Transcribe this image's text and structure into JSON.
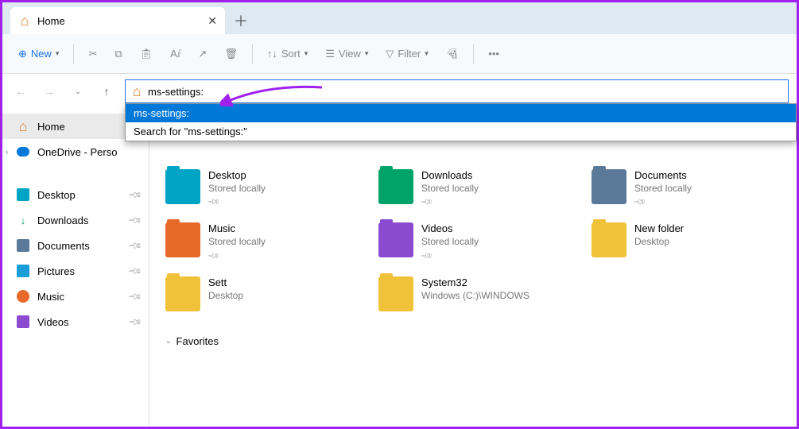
{
  "tab": {
    "title": "Home"
  },
  "toolbar": {
    "new_label": "New",
    "sort_label": "Sort",
    "view_label": "View",
    "filter_label": "Filter"
  },
  "address": {
    "value": "ms-settings:",
    "suggestions": [
      "ms-settings:",
      "Search for \"ms-settings:\""
    ]
  },
  "sidebar": {
    "items": [
      {
        "label": "Home",
        "icon": "home",
        "selected": true
      },
      {
        "label": "OneDrive - Perso",
        "icon": "cloud",
        "expandable": true
      }
    ],
    "pinned": [
      {
        "label": "Desktop",
        "icon": "desktop"
      },
      {
        "label": "Downloads",
        "icon": "downloads"
      },
      {
        "label": "Documents",
        "icon": "documents"
      },
      {
        "label": "Pictures",
        "icon": "pictures"
      },
      {
        "label": "Music",
        "icon": "music"
      },
      {
        "label": "Videos",
        "icon": "videos"
      }
    ]
  },
  "content": {
    "items": [
      {
        "name": "Desktop",
        "sub": "Stored locally",
        "pinned": true,
        "color": "#00a4c4"
      },
      {
        "name": "Downloads",
        "sub": "Stored locally",
        "pinned": true,
        "color": "#00a36a"
      },
      {
        "name": "Documents",
        "sub": "Stored locally",
        "pinned": true,
        "color": "#5b7a99"
      },
      {
        "name": "Music",
        "sub": "Stored locally",
        "pinned": true,
        "color": "#e86a2b"
      },
      {
        "name": "Videos",
        "sub": "Stored locally",
        "pinned": true,
        "color": "#8a4bd1"
      },
      {
        "name": "New folder",
        "sub": "Desktop",
        "pinned": false,
        "color": "#f0c23a"
      },
      {
        "name": "Sett",
        "sub": "Desktop",
        "pinned": false,
        "color": "#f0c23a"
      },
      {
        "name": "System32",
        "sub": "Windows (C:)\\WINDOWS",
        "pinned": false,
        "color": "#f0c23a"
      }
    ],
    "favorites_label": "Favorites"
  }
}
